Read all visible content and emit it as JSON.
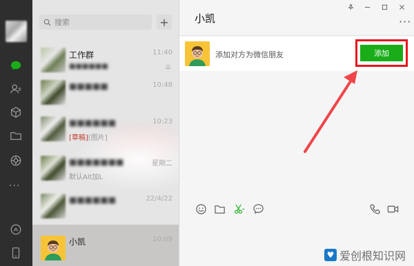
{
  "search": {
    "placeholder": "搜索"
  },
  "chats": [
    {
      "name": "工作群",
      "time": "11:40",
      "sub": ""
    },
    {
      "name": "",
      "time": "10:48",
      "sub": ""
    },
    {
      "name": "",
      "time": "10:23",
      "draft_tag": "[草稿]",
      "draft_text": "[图片]"
    },
    {
      "name": "",
      "time": "星期二",
      "sub": "默认Alt加L"
    },
    {
      "name": "",
      "time": "22/4/22",
      "sub": ""
    },
    {
      "name": "小凯",
      "time": "10:09",
      "sub": ""
    }
  ],
  "main": {
    "title": "小凯",
    "banner_text": "添加对方为微信朋友",
    "add_button": "添加"
  },
  "watermark": {
    "text": "爱创根知识网"
  },
  "colors": {
    "accent_green": "#1aad19",
    "highlight_red": "#e8141a",
    "rail_bg": "#2e2e2e"
  }
}
